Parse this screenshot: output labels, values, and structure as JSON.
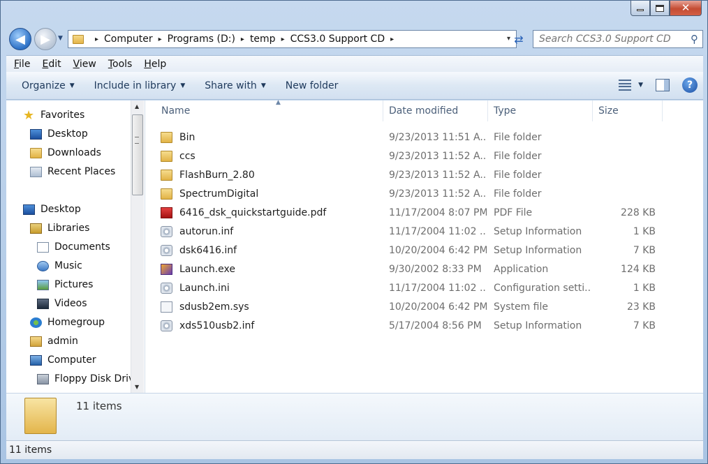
{
  "caption": {
    "minimize": "−",
    "maximize": "□",
    "close": "✕"
  },
  "address": {
    "crumbs": [
      "Computer",
      "Programs (D:)",
      "temp",
      "CCS3.0 Support CD"
    ],
    "separator": "▸",
    "dropdown": "▾"
  },
  "nav": {
    "back_icon": "arrow-left-icon",
    "forward_icon": "arrow-right-icon",
    "refresh": "⇄"
  },
  "search": {
    "placeholder": "Search CCS3.0 Support CD",
    "value": ""
  },
  "menubar": [
    {
      "label": "File"
    },
    {
      "label": "Edit"
    },
    {
      "label": "View"
    },
    {
      "label": "Tools"
    },
    {
      "label": "Help"
    }
  ],
  "commands": [
    {
      "label": "Organize",
      "has_dropdown": true
    },
    {
      "label": "Include in library",
      "has_dropdown": true
    },
    {
      "label": "Share with",
      "has_dropdown": true
    },
    {
      "label": "New folder",
      "has_dropdown": false
    }
  ],
  "navpane": [
    {
      "label": "Favorites",
      "icon": "star-icon",
      "indent": 0
    },
    {
      "label": "Desktop",
      "icon": "desktop-icon",
      "indent": 1
    },
    {
      "label": "Downloads",
      "icon": "folder-icon",
      "indent": 1
    },
    {
      "label": "Recent Places",
      "icon": "recent-places-icon",
      "indent": 1
    },
    {
      "label": "Desktop",
      "icon": "desktop-icon",
      "indent": 0
    },
    {
      "label": "Libraries",
      "icon": "libraries-icon",
      "indent": 1
    },
    {
      "label": "Documents",
      "icon": "documents-icon",
      "indent": 2
    },
    {
      "label": "Music",
      "icon": "music-icon",
      "indent": 2
    },
    {
      "label": "Pictures",
      "icon": "pictures-icon",
      "indent": 2
    },
    {
      "label": "Videos",
      "icon": "videos-icon",
      "indent": 2
    },
    {
      "label": "Homegroup",
      "icon": "homegroup-icon",
      "indent": 1
    },
    {
      "label": "admin",
      "icon": "user-folder-icon",
      "indent": 1
    },
    {
      "label": "Computer",
      "icon": "computer-icon",
      "indent": 1
    },
    {
      "label": "Floppy Disk Drive",
      "icon": "floppy-drive-icon",
      "indent": 2
    }
  ],
  "columns": {
    "name": "Name",
    "date": "Date modified",
    "type": "Type",
    "size": "Size"
  },
  "files": [
    {
      "name": "Bin",
      "date": "9/23/2013 11:51 A...",
      "type": "File folder",
      "size": "",
      "icon": "folder-icon"
    },
    {
      "name": "ccs",
      "date": "9/23/2013 11:52 A...",
      "type": "File folder",
      "size": "",
      "icon": "folder-icon"
    },
    {
      "name": "FlashBurn_2.80",
      "date": "9/23/2013 11:52 A...",
      "type": "File folder",
      "size": "",
      "icon": "folder-icon"
    },
    {
      "name": "SpectrumDigital",
      "date": "9/23/2013 11:52 A...",
      "type": "File folder",
      "size": "",
      "icon": "folder-icon"
    },
    {
      "name": "6416_dsk_quickstartguide.pdf",
      "date": "11/17/2004 8:07 PM",
      "type": "PDF File",
      "size": "228 KB",
      "icon": "pdf-icon"
    },
    {
      "name": "autorun.inf",
      "date": "11/17/2004 11:02 ...",
      "type": "Setup Information",
      "size": "1 KB",
      "icon": "setup-info-icon"
    },
    {
      "name": "dsk6416.inf",
      "date": "10/20/2004 6:42 PM",
      "type": "Setup Information",
      "size": "7 KB",
      "icon": "setup-info-icon"
    },
    {
      "name": "Launch.exe",
      "date": "9/30/2002 8:33 PM",
      "type": "Application",
      "size": "124 KB",
      "icon": "application-icon"
    },
    {
      "name": "Launch.ini",
      "date": "11/17/2004 11:02 ...",
      "type": "Configuration setti...",
      "size": "1 KB",
      "icon": "config-settings-icon"
    },
    {
      "name": "sdusb2em.sys",
      "date": "10/20/2004 6:42 PM",
      "type": "System file",
      "size": "23 KB",
      "icon": "system-file-icon"
    },
    {
      "name": "xds510usb2.inf",
      "date": "5/17/2004 8:56 PM",
      "type": "Setup Information",
      "size": "7 KB",
      "icon": "setup-info-icon"
    }
  ],
  "details": {
    "count": "11 items"
  },
  "status": {
    "text": "11 items"
  }
}
